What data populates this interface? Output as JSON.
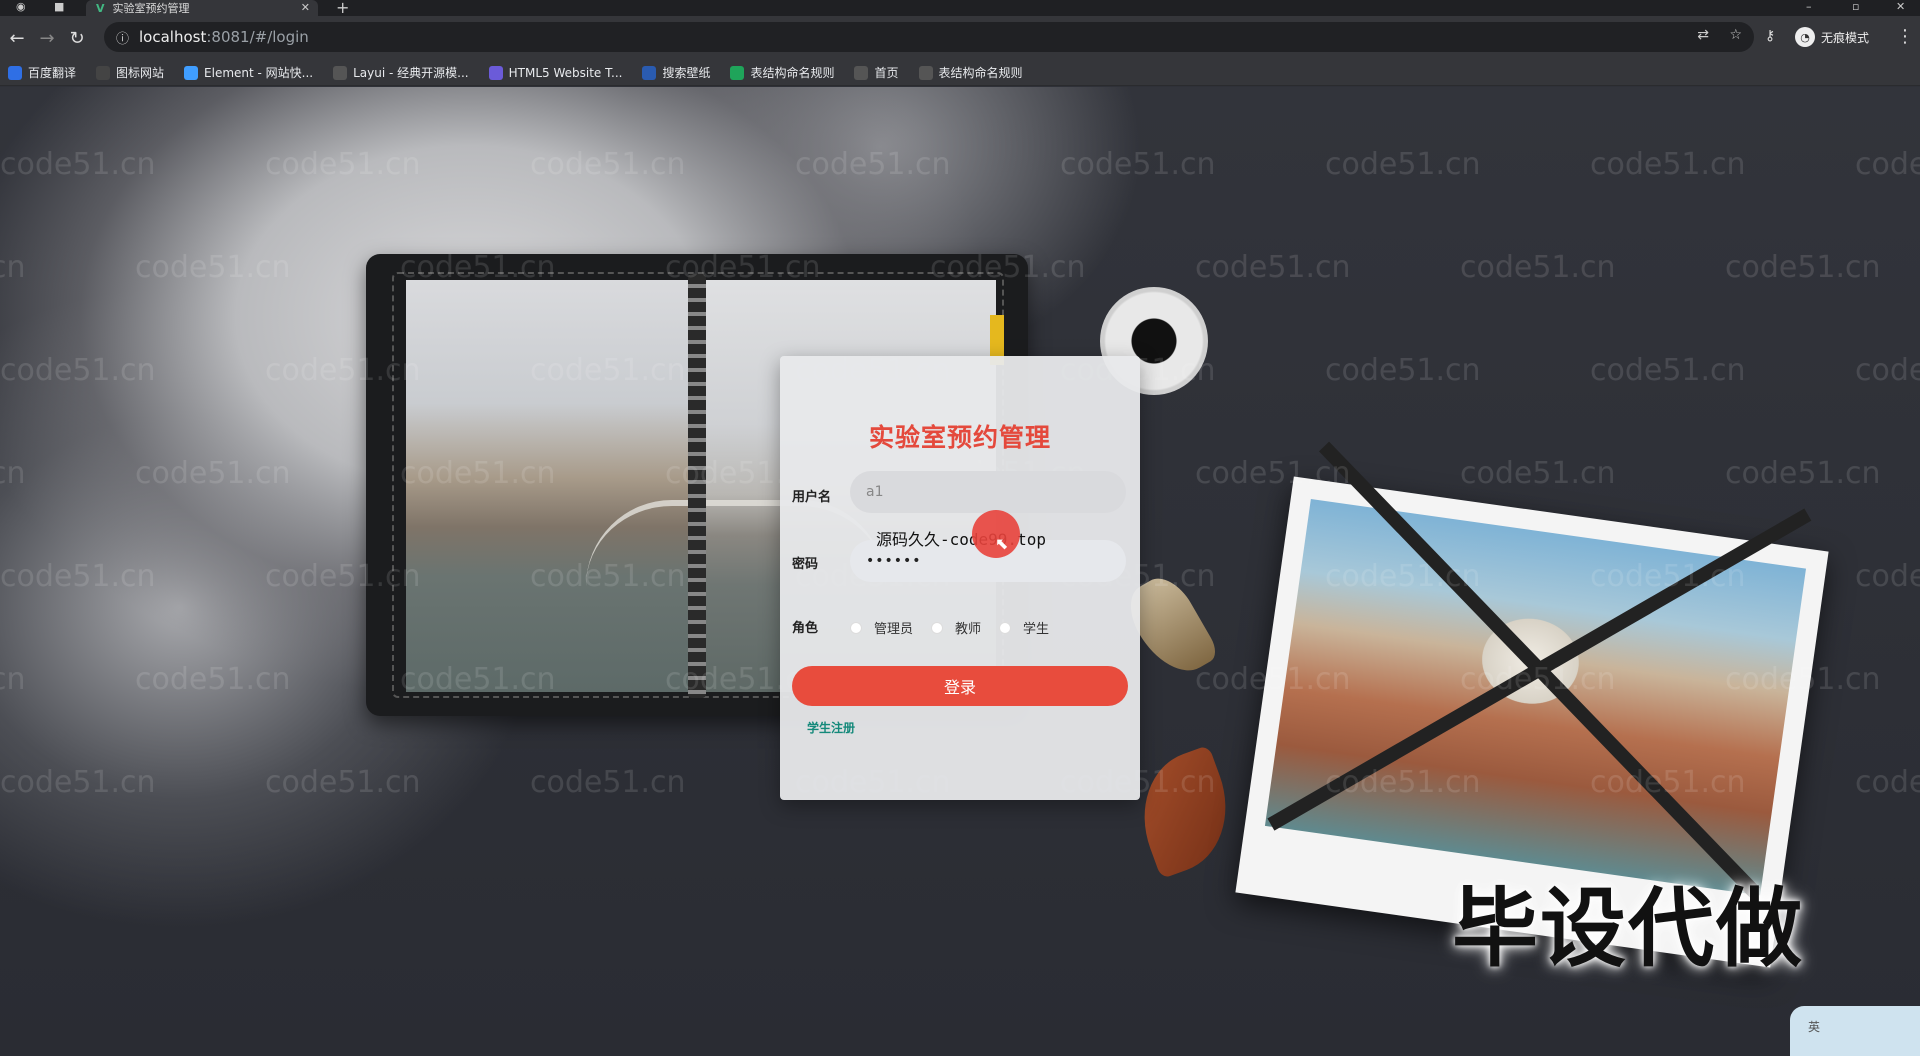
{
  "browser": {
    "tab_title": "实验室预约管理",
    "tab_favicon": "V",
    "url_host": "localhost",
    "url_path": ":8081/#/login",
    "incognito_label": "无痕模式",
    "bookmarks": [
      {
        "label": "百度翻译",
        "icon": "translate-icon",
        "color": "#2f6fe5"
      },
      {
        "label": "图标网站",
        "icon": "flag-icon",
        "color": "#444"
      },
      {
        "label": "Element - 网站快...",
        "icon": "hex-icon",
        "color": "#409eff"
      },
      {
        "label": "Layui - 经典开源模...",
        "icon": "layui-icon",
        "color": "#555"
      },
      {
        "label": "HTML5 Website T...",
        "icon": "shield-icon",
        "color": "#6b5bd9"
      },
      {
        "label": "搜索壁纸",
        "icon": "wallpaper-icon",
        "color": "#2a5bb0"
      },
      {
        "label": "表结构命名规则",
        "icon": "sheet-icon",
        "color": "#1fa45a"
      },
      {
        "label": "首页",
        "icon": "globe-icon",
        "color": "#555"
      },
      {
        "label": "表结构命名规则",
        "icon": "globe-icon",
        "color": "#555"
      }
    ]
  },
  "login": {
    "title": "实验室预约管理",
    "username_label": "用户名",
    "username_value": "a1",
    "password_label": "密码",
    "password_value": "••••••",
    "role_label": "角色",
    "roles": [
      "管理员",
      "教师",
      "学生"
    ],
    "login_button": "登录",
    "register_link": "学生注册"
  },
  "overlay": {
    "tooltip_text": "源码久久-code99.top",
    "big_text": "毕设代做",
    "watermark": "code51.cn",
    "ime_indicator": "英"
  },
  "colors": {
    "accent": "#e84c3d",
    "link": "#14897a"
  }
}
